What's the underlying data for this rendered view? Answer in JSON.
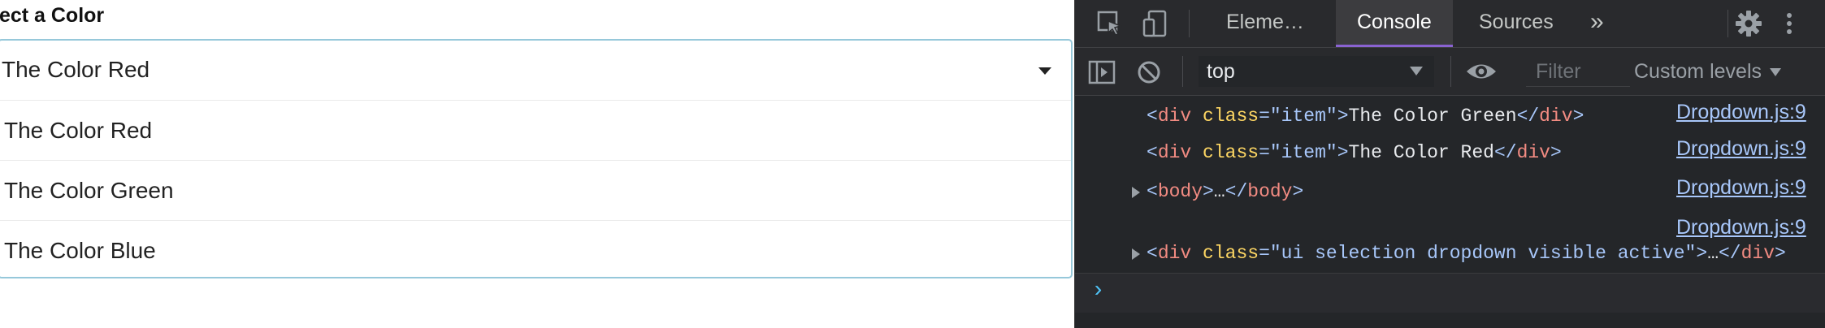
{
  "app": {
    "label": "lect a Color",
    "dropdown": {
      "selected": "The Color Red",
      "items": [
        "The Color Red",
        "The Color Green",
        "The Color Blue"
      ]
    }
  },
  "devtools": {
    "tabs": {
      "elements": "Eleme…",
      "console": "Console",
      "sources": "Sources",
      "more": "»"
    },
    "toolbar": {
      "context": "top",
      "filter_placeholder": "Filter",
      "levels": "Custom levels"
    },
    "console": {
      "rows": [
        {
          "open": "<",
          "tag": "div",
          "attr": " class",
          "eq": "=",
          "val": "\"item\"",
          "close": ">",
          "text": "The Color Green",
          "endtag_open": "</",
          "endtag": "div",
          "endtag_close": ">",
          "source": "Dropdown.js:9"
        },
        {
          "open": "<",
          "tag": "div",
          "attr": " class",
          "eq": "=",
          "val": "\"item\"",
          "close": ">",
          "text": "The Color Red",
          "endtag_open": "</",
          "endtag": "div",
          "endtag_close": ">",
          "source": "Dropdown.js:9"
        },
        {
          "open": "<",
          "tag": "body",
          "close": ">",
          "text": "…",
          "endtag_open": "</",
          "endtag": "body",
          "endtag_close": ">",
          "source": "Dropdown.js:9"
        },
        {
          "source": "Dropdown.js:9"
        },
        {
          "open": "<",
          "tag": "div",
          "attr": " class",
          "eq": "=",
          "val": "\"ui selection dropdown visible active\"",
          "close": ">",
          "text": "…",
          "endtag_open": "</",
          "endtag": "div",
          "endtag_close": ">"
        }
      ],
      "prompt": "›"
    },
    "colors": {
      "background": "#242629",
      "accent": "#8a63d2",
      "tag": "#f28b82",
      "attribute": "#fdd663",
      "link": "#a8c7fa"
    }
  }
}
